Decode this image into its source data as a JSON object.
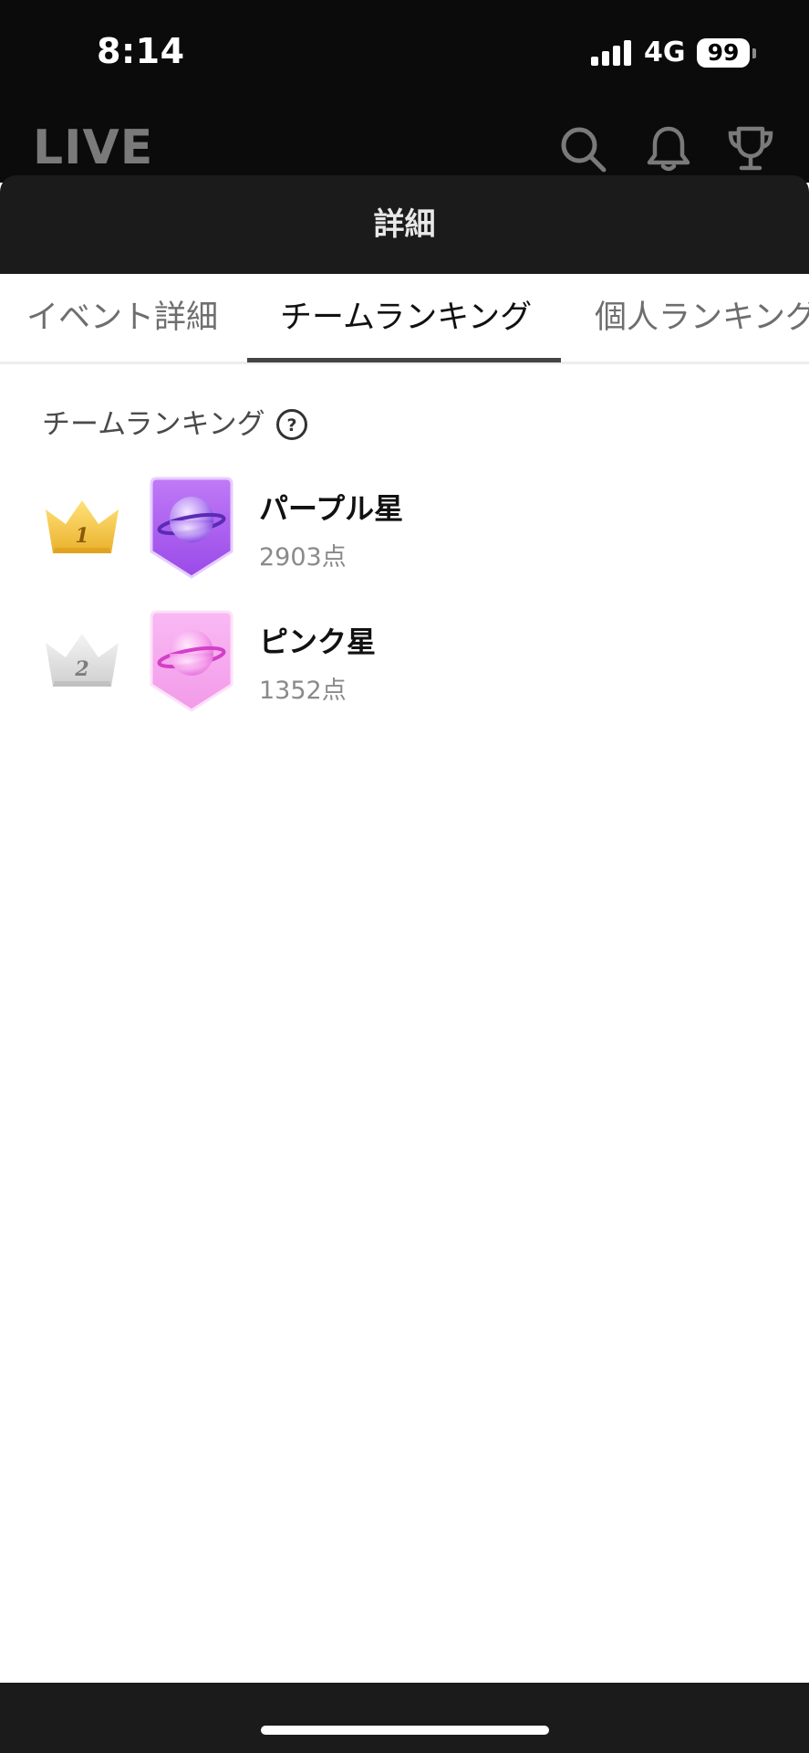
{
  "status_bar": {
    "time": "8:14",
    "network": "4G",
    "battery": "99"
  },
  "app_header": {
    "title": "LIVE",
    "icons": [
      "search-icon",
      "bell-icon",
      "trophy-icon"
    ]
  },
  "sheet": {
    "title": "詳細"
  },
  "tabs": [
    {
      "label": "イベント詳細",
      "active": false
    },
    {
      "label": "チームランキング",
      "active": true
    },
    {
      "label": "個人ランキング",
      "active": false
    }
  ],
  "section": {
    "title": "チームランキング",
    "help_icon": "question-circle-icon"
  },
  "ranking": [
    {
      "rank": "1",
      "name": "パープル星",
      "score": "2903点",
      "crown_color": "#f3c640",
      "badge_color": "#b061f0"
    },
    {
      "rank": "2",
      "name": "ピンク星",
      "score": "1352点",
      "crown_color": "#dcdcdc",
      "badge_color": "#f5a8ee"
    }
  ],
  "colors": {
    "dark_bg": "#0b0b0b",
    "sheet_header": "#1b1b1b",
    "active_tab_indicator": "#444444"
  }
}
